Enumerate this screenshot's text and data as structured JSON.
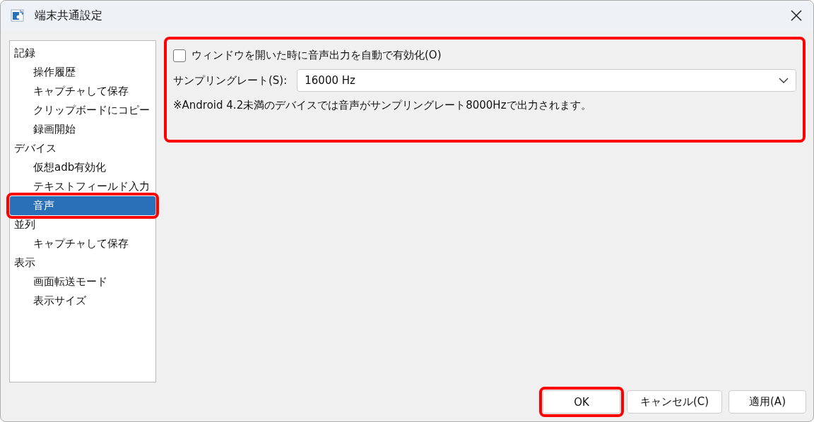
{
  "window": {
    "title": "端末共通設定"
  },
  "sidebar": {
    "items": [
      {
        "label": "記録",
        "selected": false,
        "highlighted": false,
        "children": [
          {
            "label": "操作履歴",
            "selected": false,
            "highlighted": false
          },
          {
            "label": "キャプチャして保存",
            "selected": false,
            "highlighted": false
          },
          {
            "label": "クリップボードにコピー",
            "selected": false,
            "highlighted": false
          },
          {
            "label": "録画開始",
            "selected": false,
            "highlighted": false
          }
        ]
      },
      {
        "label": "デバイス",
        "selected": false,
        "highlighted": false,
        "children": [
          {
            "label": "仮想adb有効化",
            "selected": false,
            "highlighted": false
          },
          {
            "label": "テキストフィールド入力",
            "selected": false,
            "highlighted": false
          },
          {
            "label": "音声",
            "selected": true,
            "highlighted": true
          }
        ]
      },
      {
        "label": "並列",
        "selected": false,
        "highlighted": false,
        "children": [
          {
            "label": "キャプチャして保存",
            "selected": false,
            "highlighted": false
          }
        ]
      },
      {
        "label": "表示",
        "selected": false,
        "highlighted": false,
        "children": [
          {
            "label": "画面転送モード",
            "selected": false,
            "highlighted": false
          },
          {
            "label": "表示サイズ",
            "selected": false,
            "highlighted": false
          }
        ]
      }
    ]
  },
  "panel": {
    "highlighted": true,
    "auto_enable": {
      "label": "ウィンドウを開いた時に音声出力を自動で有効化(O)",
      "checked": false
    },
    "sampling_rate": {
      "label": "サンプリングレート(S):",
      "value": "16000 Hz"
    },
    "note": "※Android 4.2未満のデバイスでは音声がサンプリングレート8000Hzで出力されます。"
  },
  "buttons": [
    {
      "label": "OK",
      "highlighted": true
    },
    {
      "label": "キャンセル(C)",
      "highlighted": false
    },
    {
      "label": "適用(A)",
      "highlighted": false
    }
  ]
}
